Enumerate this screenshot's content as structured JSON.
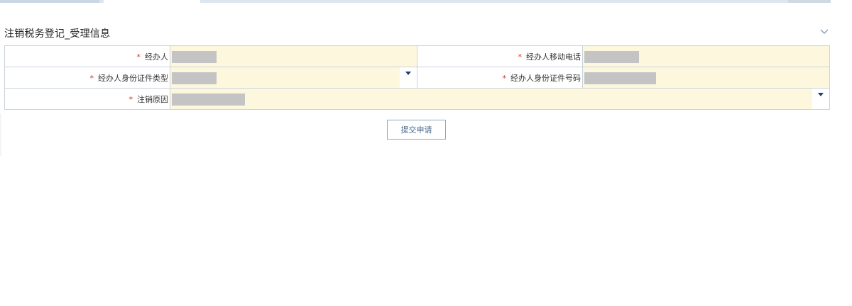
{
  "section": {
    "title": "注销税务登记_受理信息",
    "collapse_icon": "chevron-down-icon"
  },
  "form": {
    "required_mark": "*",
    "fields": {
      "agent_name": {
        "label": "经办人"
      },
      "agent_mobile": {
        "label": "经办人移动电话"
      },
      "agent_id_type": {
        "label": "经办人身份证件类型"
      },
      "agent_id_number": {
        "label": "经办人身份证件号码"
      },
      "cancel_reason": {
        "label": "注销原因"
      }
    }
  },
  "actions": {
    "submit_label": "提交申请"
  },
  "colors": {
    "required": "#d0312d",
    "field_bg": "#fdf8dd",
    "border": "#c9d2dc",
    "masked": "#c4c4c4"
  }
}
